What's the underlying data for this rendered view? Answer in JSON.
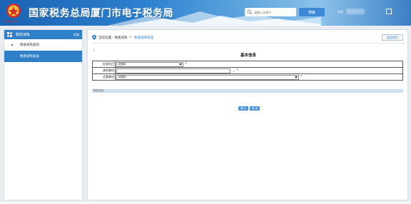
{
  "header": {
    "title": "国家税务总局厦门市电子税务局",
    "emblem_text": "国家税务总局",
    "search_placeholder": "请输入关键字",
    "search_button": "搜索",
    "welcome": "欢迎"
  },
  "sidebar": {
    "header_label": "税收减免",
    "header_control": "定制",
    "items": [
      {
        "label": "税收减免查询"
      },
      {
        "label": "税收减免核准"
      }
    ]
  },
  "main": {
    "breadcrumb": {
      "prefix": "当前位置：",
      "parent": "税收减免",
      "separator": ">",
      "current": "税收减免核准"
    },
    "back_button": "返回首页",
    "small_mark": "1",
    "section_title": "基本信息",
    "form": {
      "rows": [
        {
          "label": "征收项目",
          "value": "请选择",
          "required": "*"
        },
        {
          "label": "减免事项",
          "value": "",
          "required": "*"
        },
        {
          "label": "优惠事项",
          "value": "请选择",
          "required": "*"
        }
      ]
    },
    "attach_label": "附件信息",
    "buttons": {
      "confirm": "确 定",
      "cancel": "取 消"
    }
  },
  "colors": {
    "header_blue": "#1b63b4",
    "accent_blue": "#2f7fc9",
    "required_red": "#e02020"
  }
}
